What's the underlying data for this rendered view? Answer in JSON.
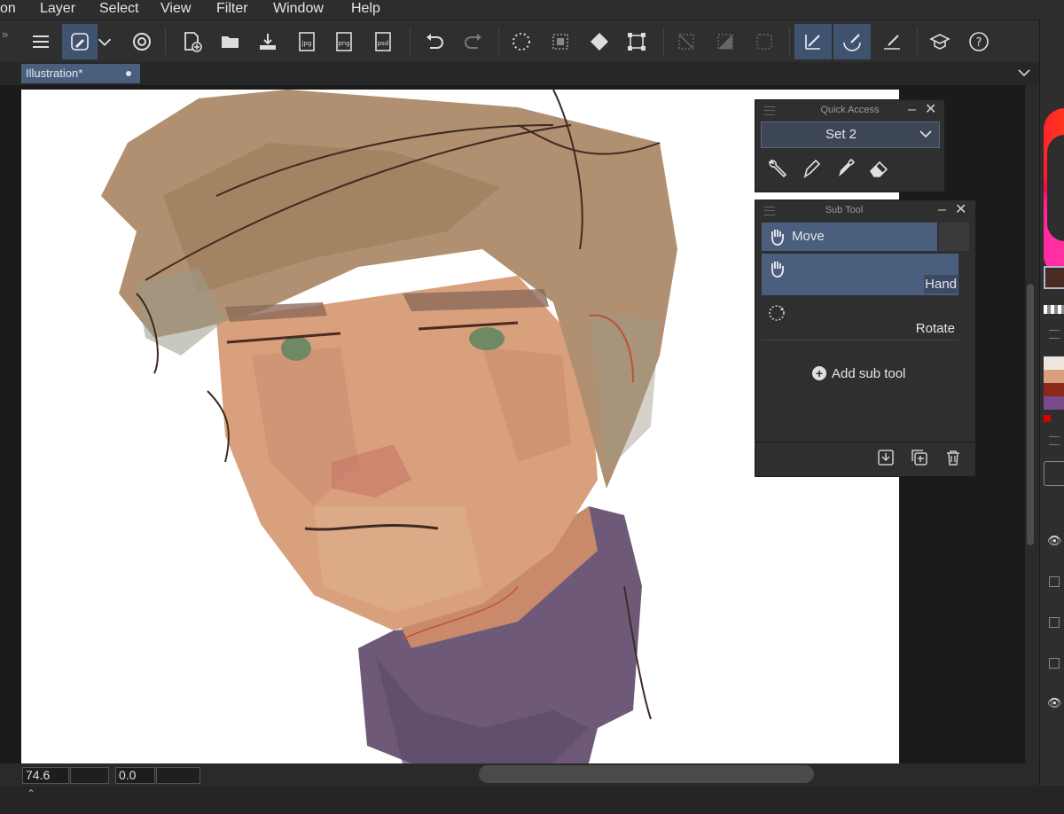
{
  "menubar": {
    "items": [
      "on",
      "Layer",
      "Select",
      "View",
      "Filter",
      "Window",
      "Help"
    ]
  },
  "toolbar": {
    "icons": [
      "menu-icon",
      "tool-pen-icon",
      "dropdown-icon",
      "spiral-icon",
      "new-file-icon",
      "open-folder-icon",
      "import-icon",
      "jpg-export-icon",
      "png-export-icon",
      "psd-export-icon",
      "undo-icon",
      "redo-icon",
      "loading-icon",
      "selection-icon",
      "fill-icon",
      "transform-icon",
      "deselect-icon",
      "invert-icon",
      "frame-icon",
      "pen-angle-icon",
      "brush-icon",
      "ruler-icon",
      "learn-icon",
      "help-icon"
    ]
  },
  "tab": {
    "title": "Illustration*"
  },
  "status": {
    "zoom": "74.6",
    "angle": "0.0"
  },
  "quick_access": {
    "title": "Quick Access",
    "set": "Set 2",
    "icons": [
      "wrench-icon",
      "pen-icon",
      "marker-icon",
      "eraser-icon"
    ]
  },
  "sub_tool": {
    "title": "Sub Tool",
    "group": "Move",
    "items": [
      {
        "label": "Hand"
      },
      {
        "label": "Rotate"
      }
    ],
    "add_label": "Add sub tool"
  },
  "colors": {
    "accent": "#4a5e7e",
    "canvas": "#ffffff",
    "skin": "#d9a07e",
    "hair": "#b09070",
    "sweater": "#6e5a78"
  }
}
